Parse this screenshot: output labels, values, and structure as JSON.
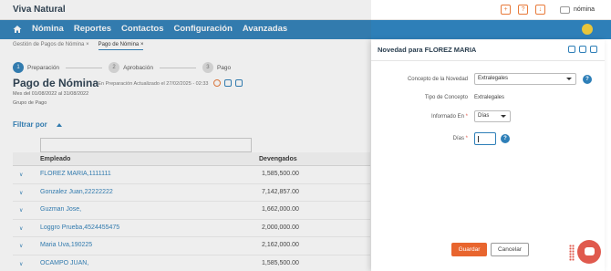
{
  "app": {
    "title": "Viva Natural",
    "user_name": "nómina"
  },
  "top_icons": [
    "plus-icon",
    "help-icon",
    "download-icon"
  ],
  "nav": {
    "items": [
      "Nómina",
      "Reportes",
      "Contactos",
      "Configuración",
      "Avanzadas"
    ]
  },
  "tabs": [
    {
      "label": "Gestión de Pagos de Nómina",
      "close": "×"
    },
    {
      "label": "Pago de Nómina",
      "close": "×"
    }
  ],
  "steps": [
    {
      "num": "1",
      "label": "Preparación"
    },
    {
      "num": "2",
      "label": "Aprobación"
    },
    {
      "num": "3",
      "label": "Pago"
    }
  ],
  "page": {
    "title": "Pago de Nómina",
    "status": "- En Preparación    Actualizado el 27/02/2025 - 02:33",
    "period": "Mes del 01/08/2022 al 31/08/2022",
    "group": "Grupo de Pago",
    "filter_label": "Filtrar por"
  },
  "table": {
    "headers": {
      "employee": "Empleado",
      "accrued": "Devengados"
    },
    "rows": [
      {
        "employee": "FLOREZ MARIA,1111111",
        "accrued": "1,585,500.00"
      },
      {
        "employee": "Gonzalez Juan,22222222",
        "accrued": "7,142,857.00"
      },
      {
        "employee": "Guzman Jose,",
        "accrued": "1,662,000.00"
      },
      {
        "employee": "Loggro Prueba,4524455475",
        "accrued": "2,000,000.00"
      },
      {
        "employee": "Maria Uva,190225",
        "accrued": "2,162,000.00"
      },
      {
        "employee": "OCAMPO JUAN,",
        "accrued": "1,585,500.00"
      }
    ]
  },
  "modal": {
    "title": "Novedad para FLOREZ MARIA",
    "concept_label": "Concepto de la Novedad",
    "concept_value": "Extralegales",
    "type_label": "Tipo de Concepto",
    "type_value": "Extralegales",
    "informed_label": "Informado En",
    "informed_value": "Días",
    "days_label": "Días",
    "days_value": "",
    "required_mark": "*",
    "save_label": "Guardar",
    "cancel_label": "Cancelar"
  },
  "colors": {
    "brand": "#2e7fb8",
    "accent": "#e8652e",
    "chat": "#e05a4e"
  }
}
